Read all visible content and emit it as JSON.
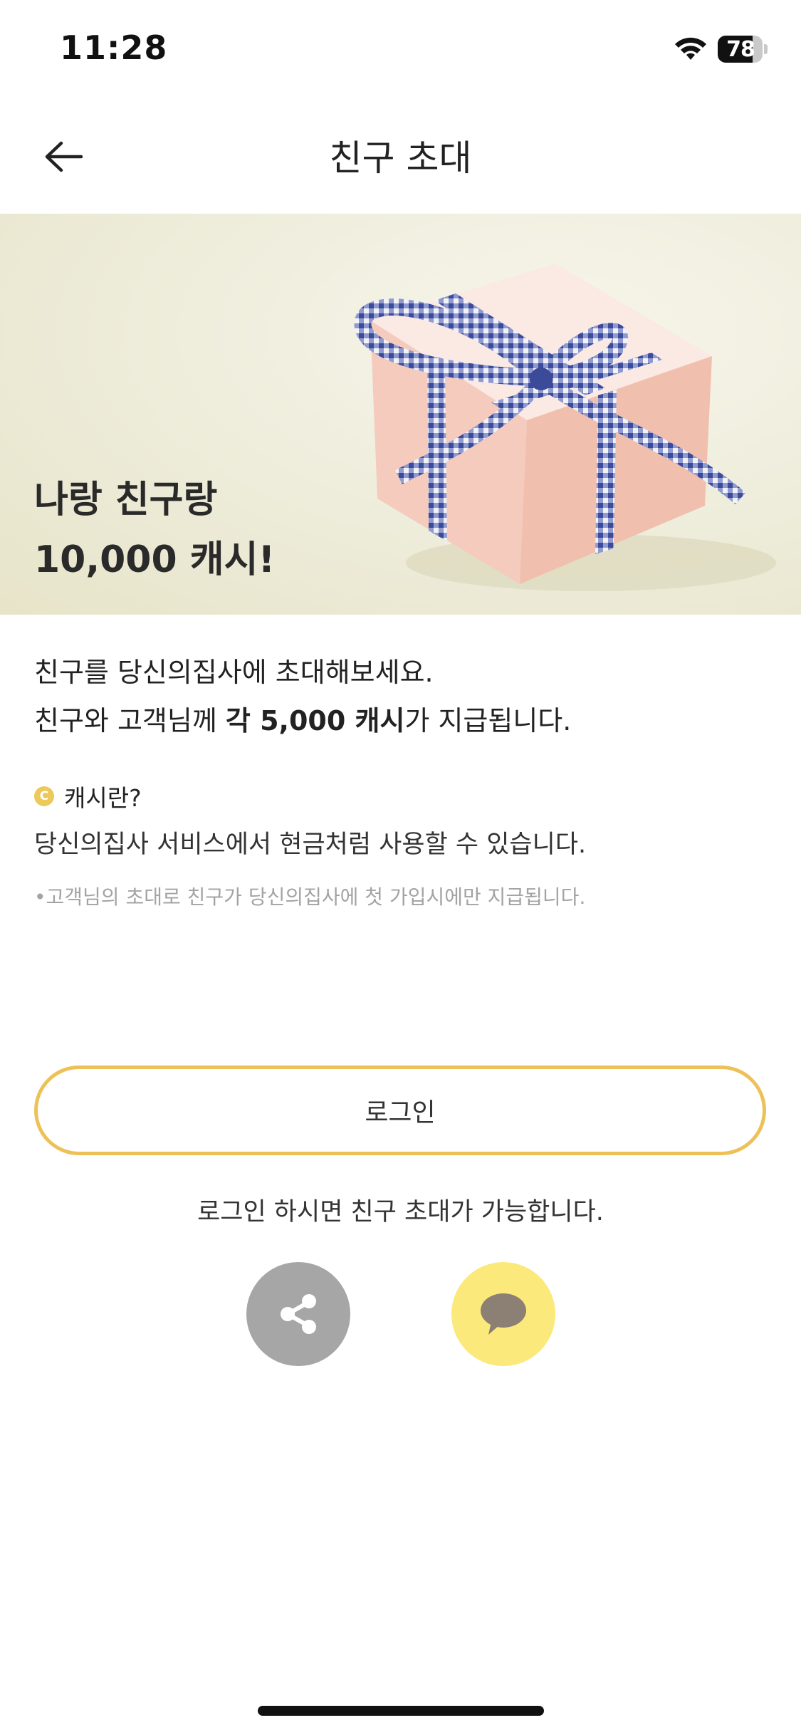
{
  "status_bar": {
    "time": "11:28",
    "battery_level": "78",
    "battery_fraction": 0.78,
    "icons": [
      "wifi-icon",
      "battery-icon"
    ]
  },
  "nav": {
    "title": "친구 초대",
    "back_icon": "back-arrow-icon"
  },
  "banner": {
    "line1": "나랑 친구랑",
    "line2": "10,000 캐시!",
    "image": "gift-box-with-ribbon"
  },
  "intro": {
    "line1": "친구를 당신의집사에 초대해보세요.",
    "line2_prefix": "친구와 고객님께 ",
    "line2_bold": "각 5,000 캐시",
    "line2_suffix": "가 지급됩니다."
  },
  "cash_info": {
    "icon_letter": "C",
    "title": "캐시란?",
    "description": "당신의집사 서비스에서 현금처럼 사용할 수 있습니다.",
    "note": "•고객님의 초대로 친구가 당신의집사에 첫 가입시에만 지급됩니다."
  },
  "login": {
    "button_label": "로그인",
    "hint": "로그인 하시면 친구 초대가 가능합니다."
  },
  "share": {
    "share_icon": "share-icon",
    "kakao_icon": "kakao-talk-icon"
  },
  "colors": {
    "accent_border": "#edc157",
    "coin": "#ecc95a",
    "share_bg": "#a6a6a6",
    "kakao_bg": "#fbe97c",
    "kakao_bubble": "#8c7f73"
  }
}
